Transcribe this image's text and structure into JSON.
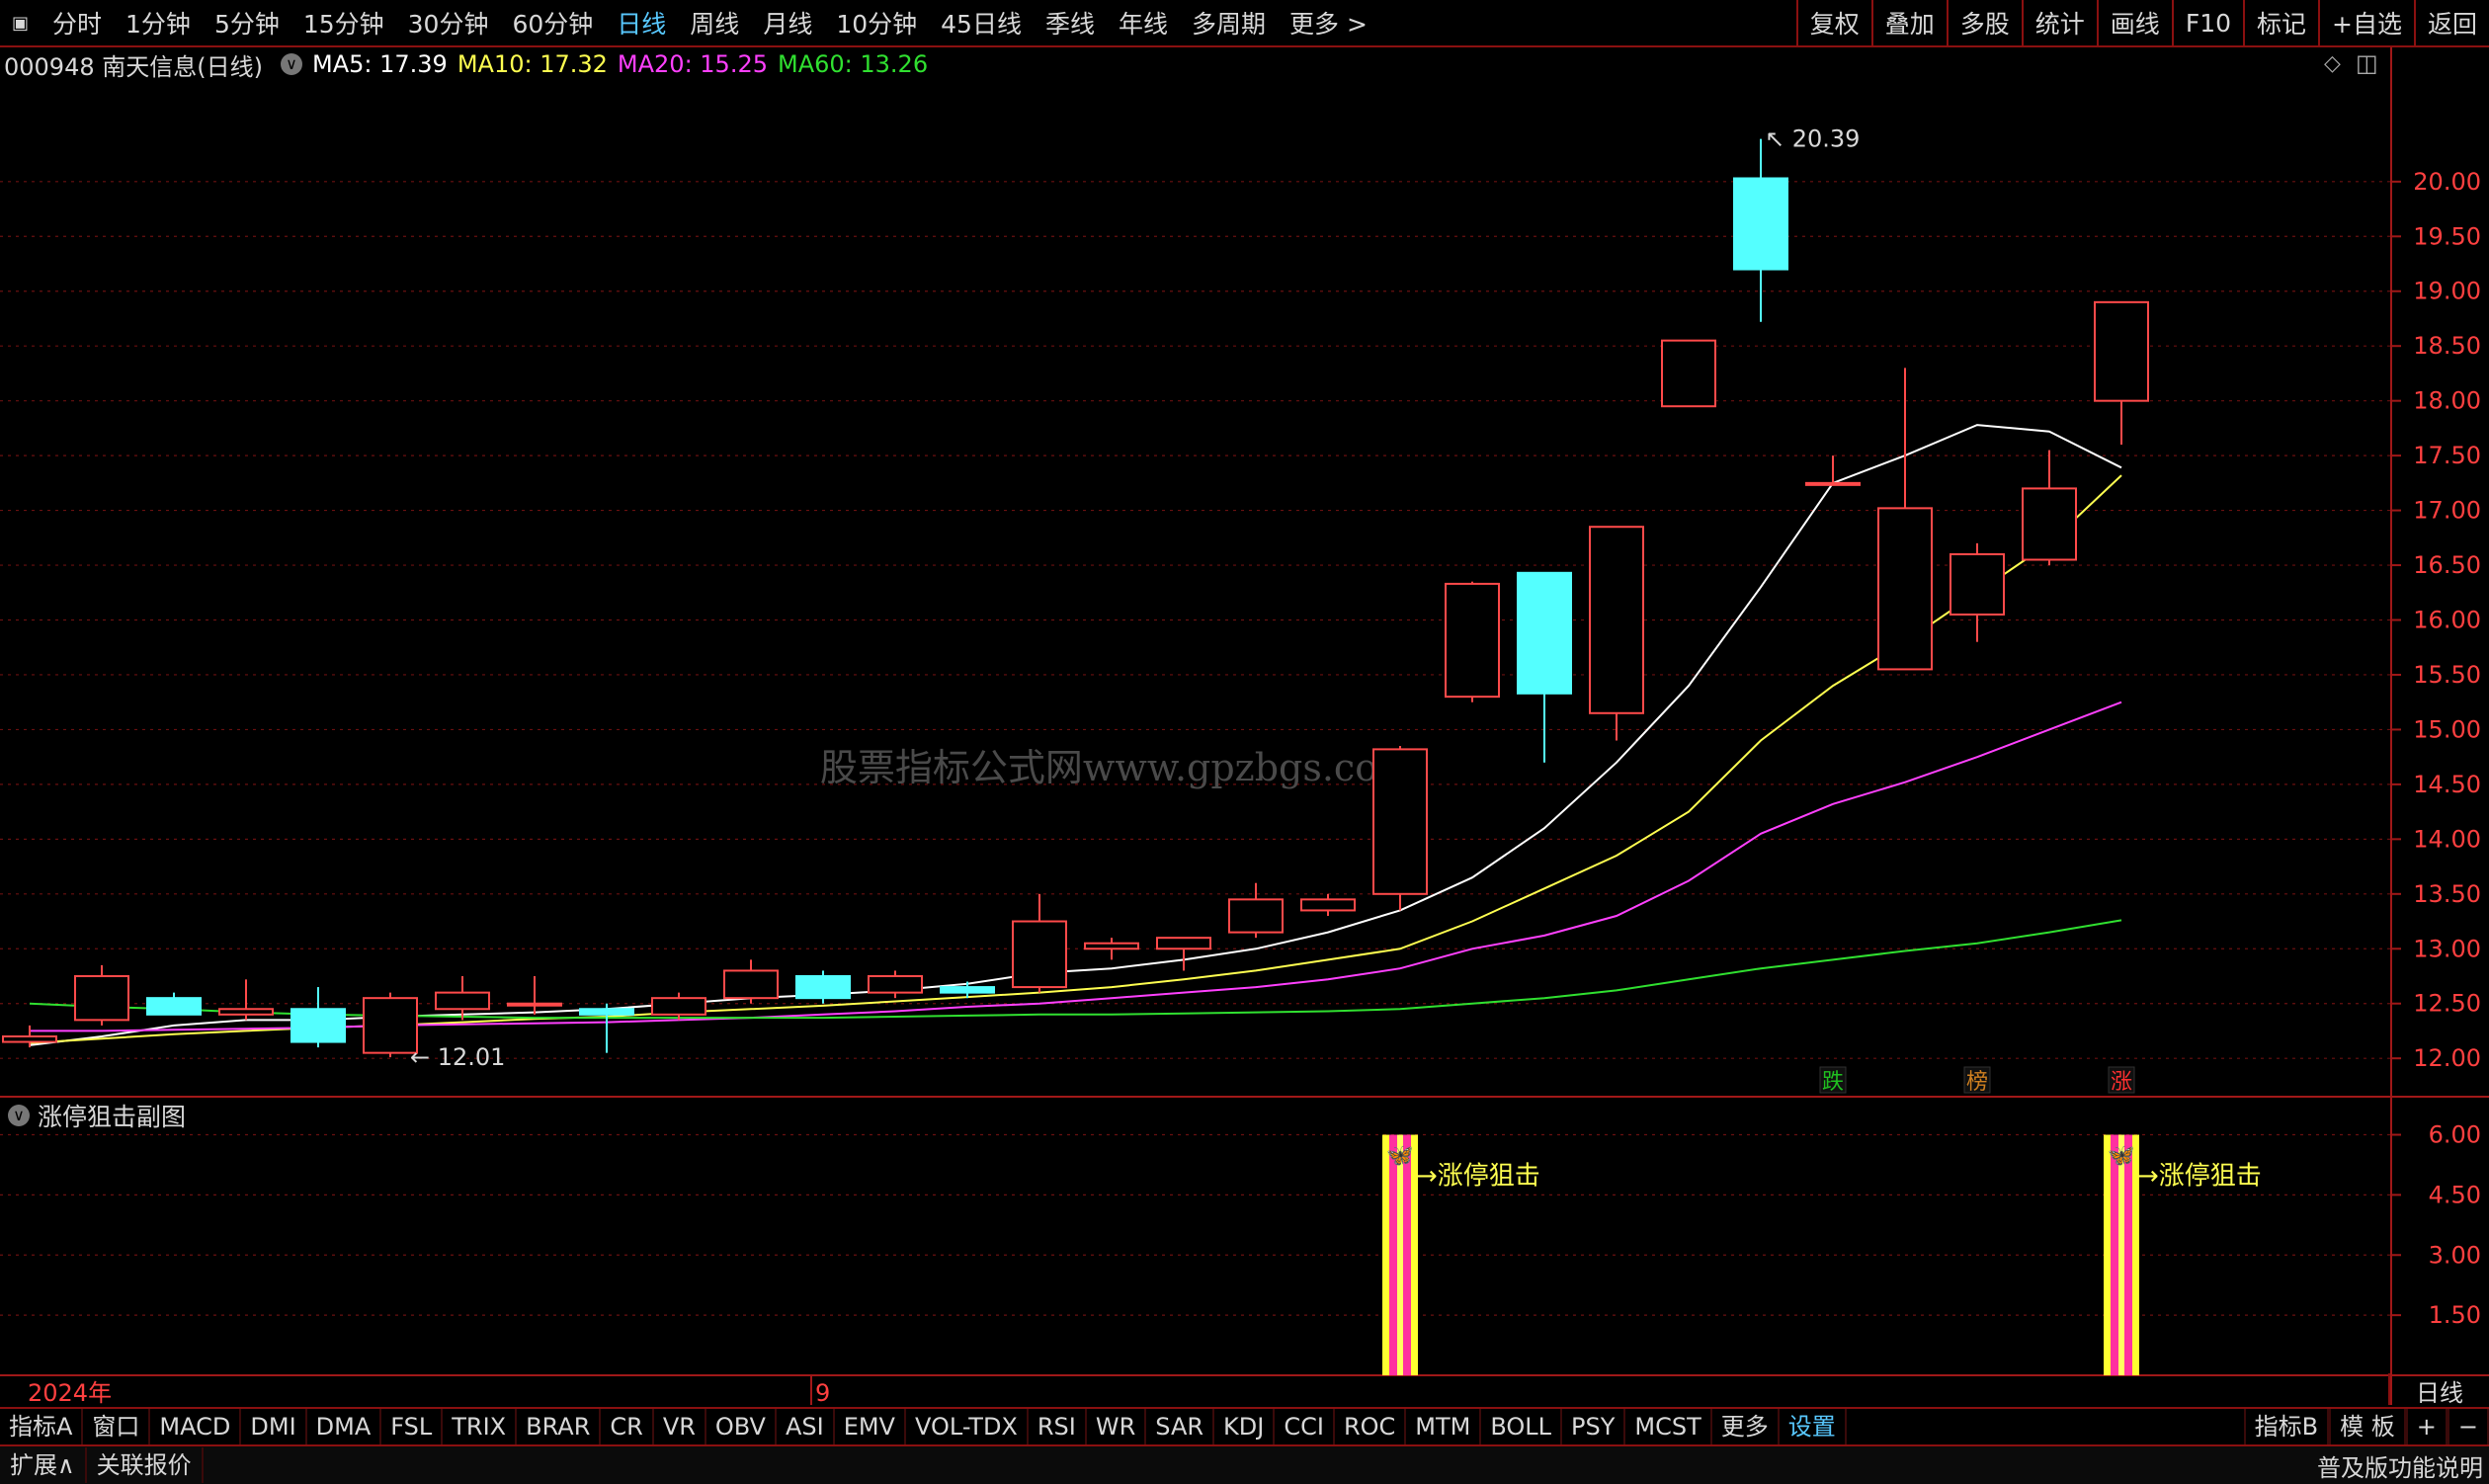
{
  "toolbar": {
    "periods": [
      "分时",
      "1分钟",
      "5分钟",
      "15分钟",
      "30分钟",
      "60分钟",
      "日线",
      "周线",
      "月线",
      "10分钟",
      "45日线",
      "季线",
      "年线",
      "多周期",
      "更多"
    ],
    "active_period": "日线",
    "right_buttons": [
      "复权",
      "叠加",
      "多股",
      "统计",
      "画线",
      "F10",
      "标记",
      "+自选",
      "返回"
    ]
  },
  "info": {
    "code_name": "000948 南天信息(日线)",
    "ma5": "MA5: 17.39",
    "ma10": "MA10: 17.32",
    "ma20": "MA20: 15.25",
    "ma60": "MA60: 13.26"
  },
  "colors": {
    "bg": "#000000",
    "grid": "#6a1010",
    "up": "#ff4a4a",
    "down": "#54ffff",
    "ma5": "#ffffff",
    "ma10": "#ffff50",
    "ma20": "#ff40ff",
    "ma60": "#30e030",
    "axis_text": "#ff4040",
    "sub_text": "#ffff50"
  },
  "subchart": {
    "title": "涨停狙击副图",
    "signal_label": "涨停狙击"
  },
  "bottom": {
    "indicators": [
      "指标A",
      "窗口",
      "MACD",
      "DMI",
      "DMA",
      "FSL",
      "TRIX",
      "BRAR",
      "CR",
      "VR",
      "OBV",
      "ASI",
      "EMV",
      "VOL-TDX",
      "RSI",
      "WR",
      "SAR",
      "KDJ",
      "CCI",
      "ROC",
      "MTM",
      "BOLL",
      "PSY",
      "MCST",
      "更多",
      "设置"
    ],
    "right_buttons": [
      "指标B",
      "模 板",
      "+",
      "−"
    ],
    "row2_left": [
      "扩展∧",
      "关联报价"
    ],
    "row2_right": "普及版功能说明",
    "period_label": "日线"
  },
  "watermark": "股票指标公式网www.gpzbgs.com",
  "chart_data": [
    {
      "type": "candlestick",
      "y_ticks": [
        "20.00",
        "19.50",
        "19.00",
        "18.50",
        "18.00",
        "17.50",
        "17.00",
        "16.50",
        "16.00",
        "15.50",
        "15.00",
        "14.50",
        "14.00",
        "13.50",
        "13.00",
        "12.50",
        "12.00"
      ],
      "ylim": [
        11.65,
        20.9
      ],
      "x_labels": [
        {
          "index": 0,
          "text": "2024年"
        },
        {
          "index": 11,
          "text": "9"
        }
      ],
      "annotations": [
        {
          "index": 24,
          "value": 20.39,
          "text": "20.39"
        },
        {
          "index": 5,
          "value": 12.01,
          "text": "12.01"
        }
      ],
      "markers": [
        {
          "index": 25,
          "text": "跌",
          "color": "#20c020"
        },
        {
          "index": 27,
          "text": "榜",
          "color": "#d08020"
        },
        {
          "index": 29,
          "text": "涨",
          "color": "#ff3030"
        }
      ],
      "candles": [
        {
          "o": 12.15,
          "h": 12.3,
          "l": 12.1,
          "c": 12.2
        },
        {
          "o": 12.35,
          "h": 12.85,
          "l": 12.3,
          "c": 12.75
        },
        {
          "o": 12.55,
          "h": 12.6,
          "l": 12.4,
          "c": 12.4
        },
        {
          "o": 12.4,
          "h": 12.72,
          "l": 12.35,
          "c": 12.45
        },
        {
          "o": 12.45,
          "h": 12.65,
          "l": 12.1,
          "c": 12.15
        },
        {
          "o": 12.05,
          "h": 12.6,
          "l": 12.01,
          "c": 12.55
        },
        {
          "o": 12.45,
          "h": 12.75,
          "l": 12.35,
          "c": 12.6
        },
        {
          "o": 12.5,
          "h": 12.75,
          "l": 12.4,
          "c": 12.5
        },
        {
          "o": 12.45,
          "h": 12.5,
          "l": 12.05,
          "c": 12.4
        },
        {
          "o": 12.4,
          "h": 12.6,
          "l": 12.35,
          "c": 12.55
        },
        {
          "o": 12.55,
          "h": 12.9,
          "l": 12.5,
          "c": 12.8
        },
        {
          "o": 12.75,
          "h": 12.8,
          "l": 12.5,
          "c": 12.55
        },
        {
          "o": 12.6,
          "h": 12.8,
          "l": 12.55,
          "c": 12.75
        },
        {
          "o": 12.65,
          "h": 12.7,
          "l": 12.55,
          "c": 12.6
        },
        {
          "o": 12.65,
          "h": 13.5,
          "l": 12.6,
          "c": 13.25
        },
        {
          "o": 13.0,
          "h": 13.1,
          "l": 12.9,
          "c": 13.05
        },
        {
          "o": 13.0,
          "h": 13.1,
          "l": 12.8,
          "c": 13.1
        },
        {
          "o": 13.15,
          "h": 13.6,
          "l": 13.1,
          "c": 13.45
        },
        {
          "o": 13.35,
          "h": 13.5,
          "l": 13.3,
          "c": 13.45
        },
        {
          "o": 13.5,
          "h": 14.85,
          "l": 13.35,
          "c": 14.82
        },
        {
          "o": 15.3,
          "h": 16.35,
          "l": 15.25,
          "c": 16.33
        },
        {
          "o": 16.43,
          "h": 16.43,
          "l": 14.7,
          "c": 15.33
        },
        {
          "o": 15.15,
          "h": 16.85,
          "l": 14.9,
          "c": 16.85
        },
        {
          "o": 17.95,
          "h": 18.55,
          "l": 17.95,
          "c": 18.55
        },
        {
          "o": 20.03,
          "h": 20.39,
          "l": 18.72,
          "c": 19.2
        },
        {
          "o": 17.25,
          "h": 17.5,
          "l": 17.25,
          "c": 17.25
        },
        {
          "o": 15.55,
          "h": 18.3,
          "l": 15.55,
          "c": 17.02
        },
        {
          "o": 16.05,
          "h": 16.7,
          "l": 15.8,
          "c": 16.6
        },
        {
          "o": 16.55,
          "h": 17.55,
          "l": 16.5,
          "c": 17.2
        },
        {
          "o": 18.0,
          "h": 18.9,
          "l": 17.6,
          "c": 18.9
        }
      ],
      "series": [
        {
          "name": "MA5",
          "color": "#ffffff",
          "values": [
            12.12,
            12.2,
            12.3,
            12.35,
            12.35,
            12.38,
            12.4,
            12.42,
            12.45,
            12.5,
            12.55,
            12.58,
            12.62,
            12.68,
            12.78,
            12.82,
            12.9,
            13.0,
            13.15,
            13.35,
            13.65,
            14.1,
            14.7,
            15.4,
            16.3,
            17.25,
            17.5,
            17.78,
            17.72,
            17.39
          ]
        },
        {
          "name": "MA10",
          "color": "#ffff50",
          "values": [
            12.14,
            12.18,
            12.22,
            12.25,
            12.28,
            12.3,
            12.33,
            12.36,
            12.38,
            12.42,
            12.45,
            12.48,
            12.52,
            12.56,
            12.6,
            12.65,
            12.72,
            12.8,
            12.9,
            13.0,
            13.25,
            13.55,
            13.85,
            14.25,
            14.9,
            15.4,
            15.8,
            16.25,
            16.7,
            17.32
          ]
        },
        {
          "name": "MA20",
          "color": "#ff40ff",
          "values": [
            12.25,
            12.25,
            12.26,
            12.27,
            12.28,
            12.3,
            12.31,
            12.32,
            12.33,
            12.35,
            12.37,
            12.4,
            12.43,
            12.47,
            12.5,
            12.55,
            12.6,
            12.65,
            12.72,
            12.82,
            13.0,
            13.12,
            13.3,
            13.62,
            14.05,
            14.32,
            14.52,
            14.75,
            15.0,
            15.25
          ]
        },
        {
          "name": "MA60",
          "color": "#30e030",
          "values": [
            12.5,
            12.47,
            12.45,
            12.42,
            12.4,
            12.39,
            12.38,
            12.37,
            12.37,
            12.37,
            12.37,
            12.37,
            12.38,
            12.39,
            12.4,
            12.4,
            12.41,
            12.42,
            12.43,
            12.45,
            12.5,
            12.55,
            12.62,
            12.72,
            12.82,
            12.9,
            12.98,
            13.05,
            13.15,
            13.26
          ]
        }
      ]
    },
    {
      "type": "bar",
      "title": "涨停狙击副图",
      "y_ticks": [
        "6.00",
        "4.50",
        "3.00",
        "1.50"
      ],
      "ylim": [
        0,
        6.9
      ],
      "signals": [
        {
          "index": 19,
          "value": 6
        },
        {
          "index": 29,
          "value": 6
        }
      ]
    }
  ]
}
